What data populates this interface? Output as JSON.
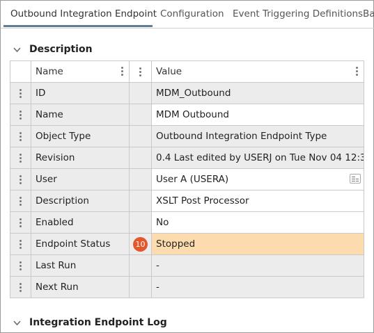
{
  "tabs": [
    {
      "label": "Outbound Integration Endpoint",
      "active": true
    },
    {
      "label": "Configuration",
      "active": false
    },
    {
      "label": "Event Triggering Definitions",
      "active": false
    },
    {
      "label": "Ba",
      "active": false
    }
  ],
  "description_section": {
    "title": "Description",
    "columns": {
      "name": "Name",
      "value": "Value"
    },
    "rows": [
      {
        "name": "ID",
        "value": "MDM_Outbound"
      },
      {
        "name": "Name",
        "value": "MDM Outbound"
      },
      {
        "name": "Object Type",
        "value": "Outbound Integration Endpoint Type"
      },
      {
        "name": "Revision",
        "value": "0.4 Last edited by USERJ on Tue Nov 04 12:3..."
      },
      {
        "name": "User",
        "value": "User A (USERA)"
      },
      {
        "name": "Description",
        "value": "XSLT Post Processor"
      },
      {
        "name": "Enabled",
        "value": "No"
      },
      {
        "name": "Endpoint Status",
        "value": "Stopped",
        "badge": "10",
        "highlight_color": "#fcdcae"
      },
      {
        "name": "Last Run",
        "value": "-"
      },
      {
        "name": "Next Run",
        "value": "-"
      }
    ]
  },
  "log_section": {
    "title": "Integration Endpoint Log"
  },
  "colors": {
    "tab_underline": "#5b7f9a",
    "badge": "#e2582c",
    "row_shade": "#ececec"
  }
}
